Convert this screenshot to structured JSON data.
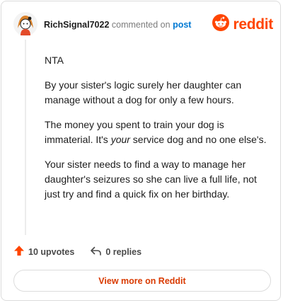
{
  "comment": {
    "username": "RichSignal7022",
    "commented_on": "commented on",
    "post_label": "post",
    "paragraphs": {
      "p1": "NTA",
      "p2": "By your sister's logic surely her daughter can manage without a dog for only a few hours.",
      "p3_before": "The money you spent to train your dog is immaterial. It's ",
      "p3_emphasis": "your",
      "p3_after": " service dog and no one else's.",
      "p4": "Your sister needs to find a way to manage her daughter's seizures so she can live a full life, not just try and find a quick fix on her birthday."
    }
  },
  "logo": {
    "wordmark": "reddit"
  },
  "actions": {
    "upvotes_label": "10 upvotes",
    "replies_label": "0 replies"
  },
  "view_more_label": "View more on Reddit",
  "colors": {
    "brand": "#ff4500",
    "upvote": "#ff4500",
    "link": "#0079d3",
    "view_more_text": "#d93a00"
  },
  "icons": {
    "avatar": "user-avatar-icon",
    "logo": "reddit-alien-icon",
    "upvote": "upvote-arrow-icon",
    "reply": "reply-arrow-icon"
  }
}
